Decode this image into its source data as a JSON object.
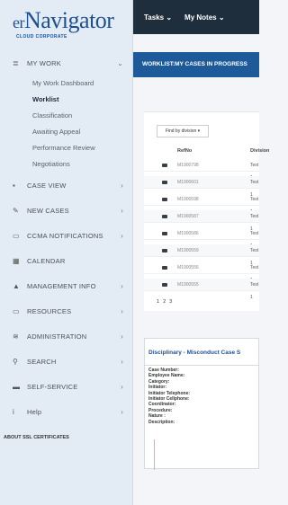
{
  "logo": {
    "main": "Navigator",
    "prefix": "er",
    "sub": "CLOUD CORPORATE"
  },
  "sidebar": {
    "sections": [
      {
        "key": "mywork",
        "label": "MY WORK",
        "icon": "list-icon",
        "chev": "⌄"
      },
      {
        "key": "caseview",
        "label": "CASE VIEW",
        "icon": "briefcase-icon",
        "chev": "›"
      },
      {
        "key": "newcases",
        "label": "NEW CASES",
        "icon": "edit-icon",
        "chev": "›"
      },
      {
        "key": "ccma",
        "label": "CCMA NOTIFICATIONS",
        "icon": "notification-icon",
        "chev": "›"
      },
      {
        "key": "calendar",
        "label": "CALENDAR",
        "icon": "calendar-icon",
        "chev": ""
      },
      {
        "key": "mgmt",
        "label": "MANAGEMENT INFO",
        "icon": "user-icon",
        "chev": "›"
      },
      {
        "key": "resources",
        "label": "RESOURCES",
        "icon": "folder-icon",
        "chev": "›"
      },
      {
        "key": "admin",
        "label": "ADMINISTRATION",
        "icon": "settings-icon",
        "chev": "›"
      },
      {
        "key": "search",
        "label": "SEARCH",
        "icon": "search-icon",
        "chev": "›"
      },
      {
        "key": "self",
        "label": "SELF-SERVICE",
        "icon": "card-icon",
        "chev": "›"
      },
      {
        "key": "help",
        "label": "Help",
        "icon": "info-icon",
        "chev": "›"
      }
    ],
    "mywork_items": [
      "My Work Dashboard",
      "Worklist",
      "Classification",
      "Awaiting Appeal",
      "Performance Review",
      "Negotiations"
    ],
    "active_item": "Worklist",
    "footer": "ABOUT SSL CERTIFICATES"
  },
  "topbar": {
    "tasks": "Tasks",
    "mynotes": "My Notes"
  },
  "breadcrumb": "WORKLIST:MY CASES IN PROGRESS",
  "worklist": {
    "filter_label": "Find by division",
    "columns": [
      "RefNo",
      "Division"
    ],
    "rows": [
      {
        "ref": "M1900798",
        "division": "Test 1"
      },
      {
        "ref": "M1900601",
        "division": "Test 1"
      },
      {
        "ref": "M1900598",
        "division": "Test 1"
      },
      {
        "ref": "M1900587",
        "division": "Test 1"
      },
      {
        "ref": "M1900586",
        "division": "Test 1"
      },
      {
        "ref": "M1900559",
        "division": "Test 1"
      },
      {
        "ref": "M1900556",
        "division": "Test 1"
      },
      {
        "ref": "M1900555",
        "division": "Test 1"
      }
    ],
    "pages": [
      "1",
      "2",
      "3"
    ]
  },
  "detail": {
    "title": "Disciplinary - Misconduct Case S",
    "fields": [
      "Case Number:",
      "Employee Name:",
      "Category:",
      "Initiator:",
      "Initiator Telephone:",
      "Initiator Cellphone:",
      "Coordinator:",
      "Procedure:",
      "Nature :",
      "Description:"
    ]
  }
}
